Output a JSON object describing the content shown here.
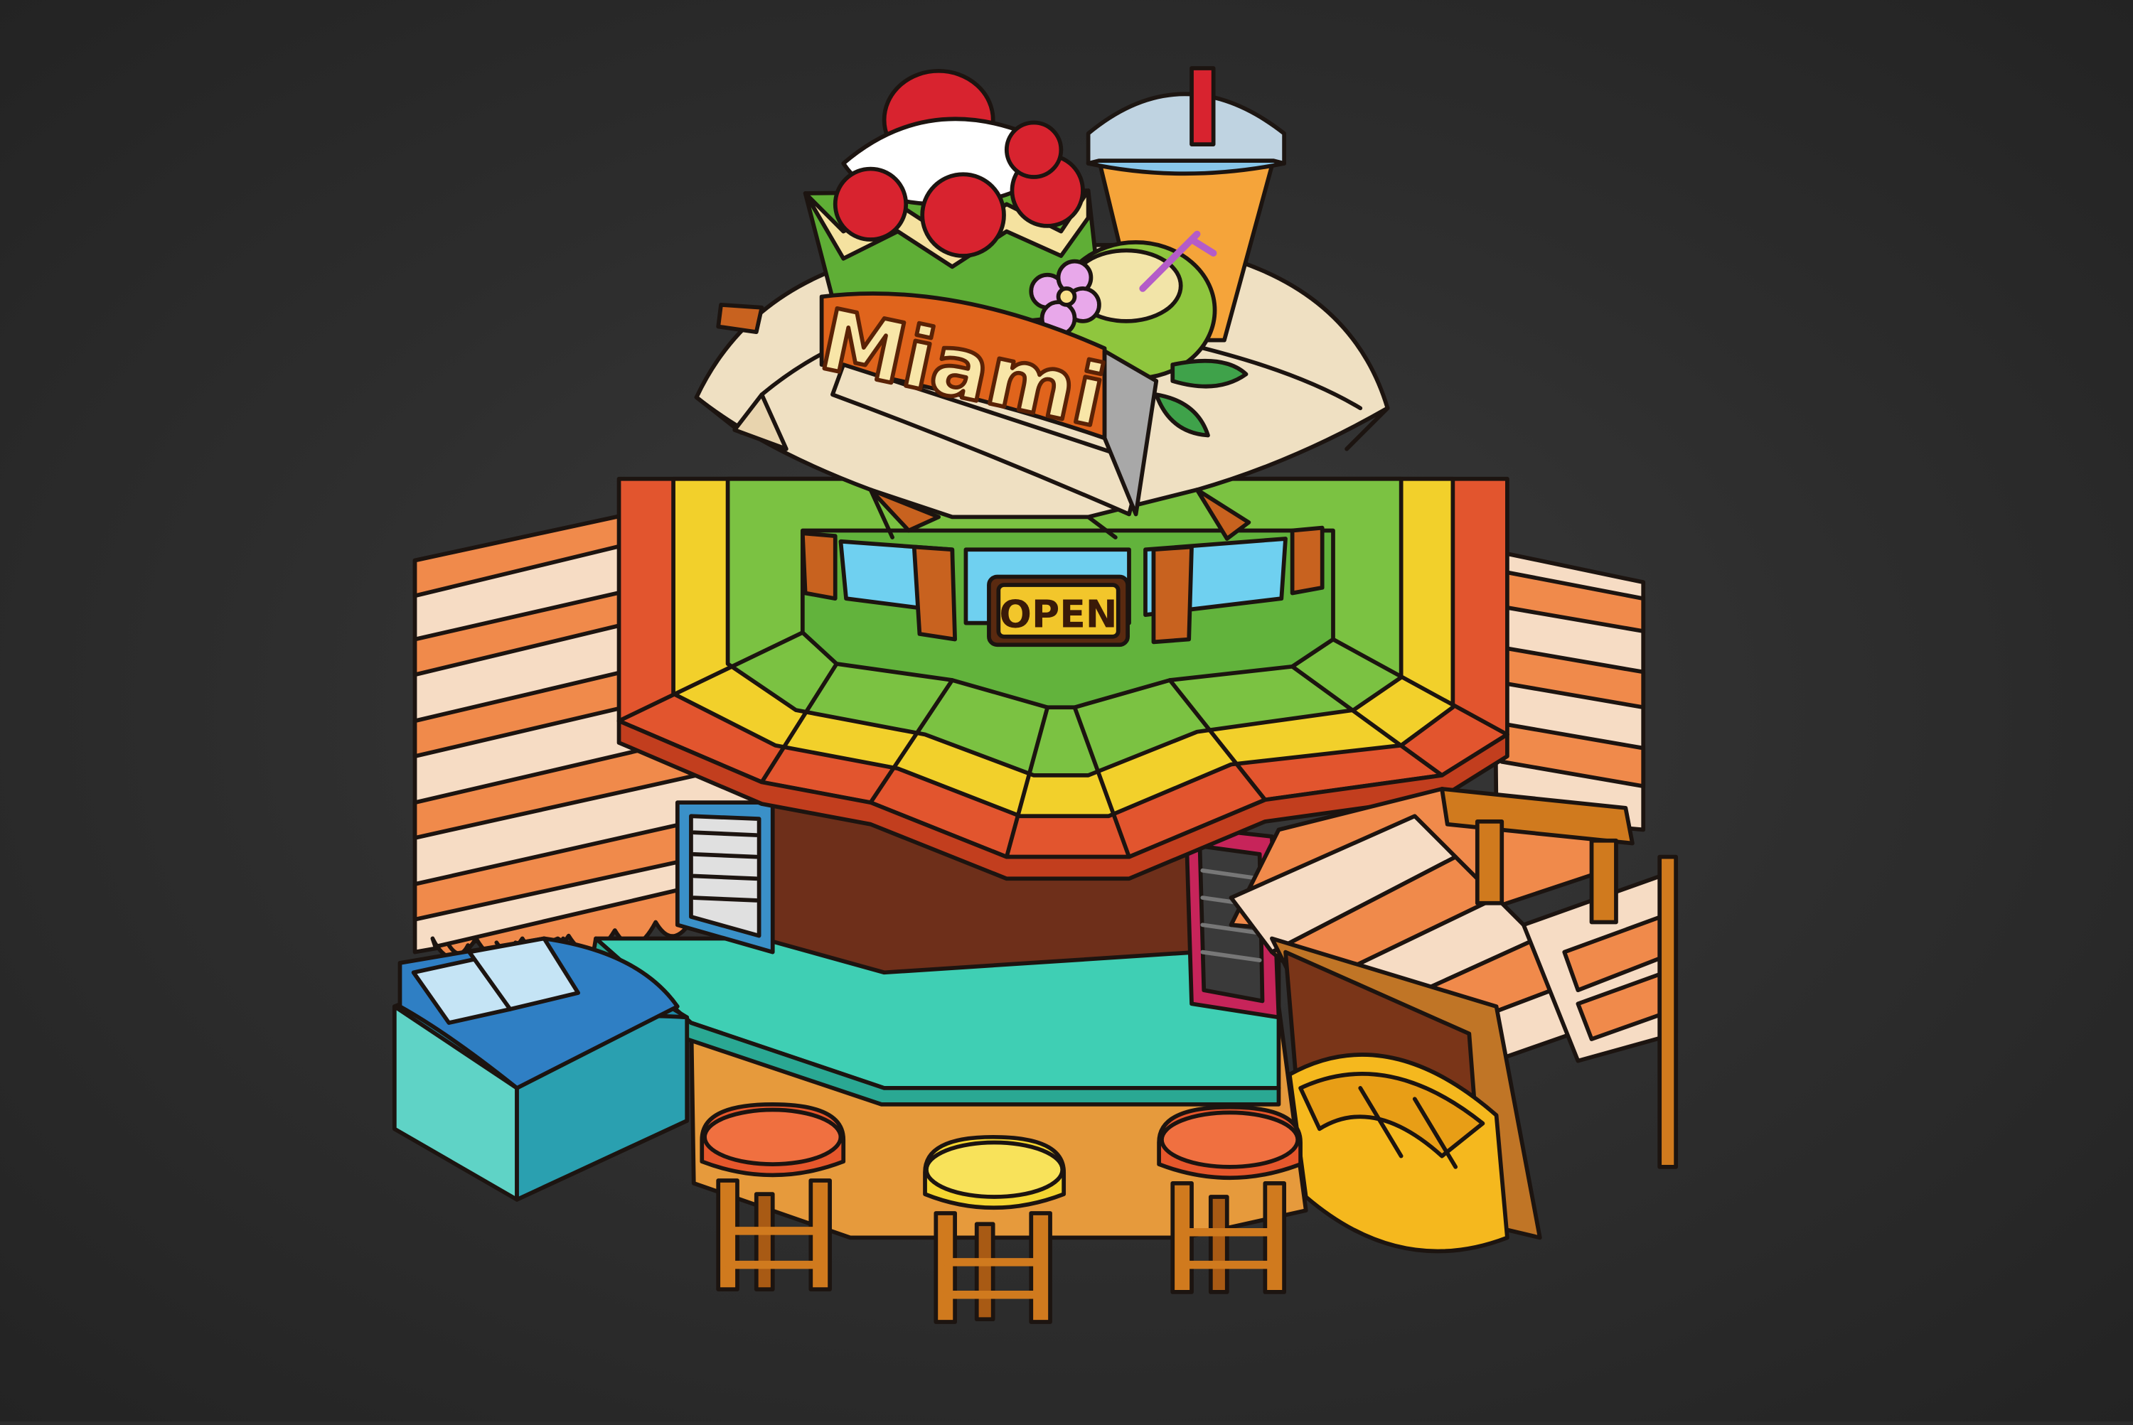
{
  "scene": {
    "sign_text": "Miami",
    "open_sign_text": "OPEN"
  },
  "palette": {
    "background": "#2d2d2d",
    "outline": "#1c1410",
    "awning_orange": "#f08a4b",
    "awning_cream": "#f6dcc4",
    "roof_red": "#e2552e",
    "roof_yellow": "#f2d02b",
    "roof_green": "#7bc242",
    "umbrella_cream": "#efe0c2",
    "counter_teal": "#3fcfb4",
    "wall_brown": "#6e2f1a",
    "base_orange": "#e69a3c",
    "sign_orange": "#e0641c",
    "sign_text_cream": "#f8e6a8",
    "stool_red": "#e6572c",
    "stool_yellow": "#f4d531",
    "cooler_blue": "#2f7fc4"
  }
}
